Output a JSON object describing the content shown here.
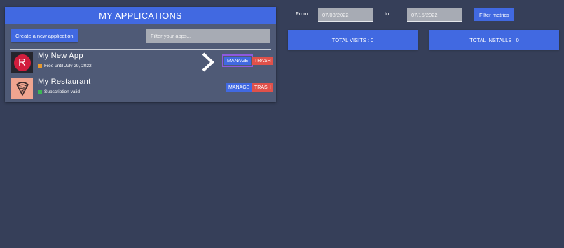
{
  "apps_panel": {
    "title": "MY APPLICATIONS",
    "create_button_label": "Create a new application",
    "filter_placeholder": "Filter your apps...",
    "apps": [
      {
        "name": "My New App",
        "status": "Free until July 29, 2022",
        "status_color": "#e79a2f",
        "icon": "r-logo-icon",
        "manage_label": "MANAGE",
        "trash_label": "TRASH"
      },
      {
        "name": "My Restaurant",
        "status": "Subscription valid",
        "status_color": "#3cb854",
        "icon": "pizza-icon",
        "manage_label": "MANAGE",
        "trash_label": "TRASH"
      }
    ]
  },
  "metrics": {
    "from_label": "From",
    "from_value": "07/08/2022",
    "to_label": "to",
    "to_value": "07/15/2022",
    "filter_button_label": "Filter metrics",
    "total_visits_label": "TOTAL VISITS : 0",
    "total_installs_label": "TOTAL INSTALLS : 0"
  },
  "colors": {
    "background": "#363f59",
    "panel": "#4f5a76",
    "accent": "#4169e1",
    "danger": "#e0514a",
    "focus_outline": "#8e59e0"
  }
}
